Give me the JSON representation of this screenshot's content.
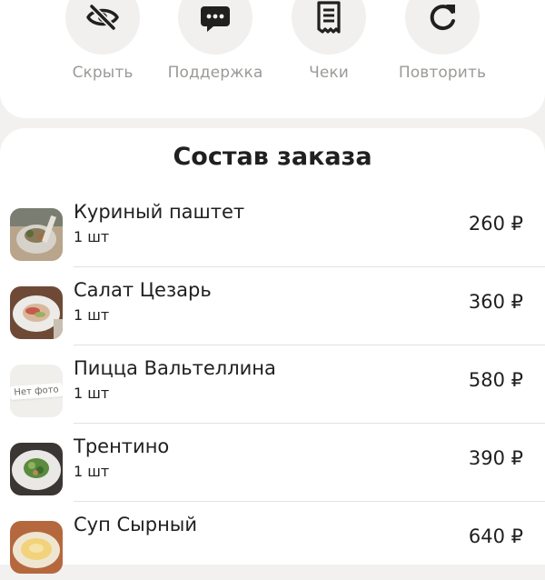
{
  "actions": [
    {
      "label": "Скрыть",
      "icon": "eye-off-icon"
    },
    {
      "label": "Поддержка",
      "icon": "chat-icon"
    },
    {
      "label": "Чеки",
      "icon": "receipt-icon"
    },
    {
      "label": "Повторить",
      "icon": "repeat-icon"
    }
  ],
  "order": {
    "title": "Состав заказа",
    "no_photo_label": "Нет фото",
    "items": [
      {
        "name": "Куриный паштет",
        "qty": "1 шт",
        "price": "260 ₽"
      },
      {
        "name": "Салат Цезарь",
        "qty": "1 шт",
        "price": "360 ₽"
      },
      {
        "name": "Пицца Вальтеллина",
        "qty": "1 шт",
        "price": "580 ₽"
      },
      {
        "name": "Трентино",
        "qty": "1 шт",
        "price": "390 ₽"
      },
      {
        "name": "Суп Сырный",
        "qty": "",
        "price": "640 ₽"
      }
    ]
  },
  "colors": {
    "background": "#f2f1ef",
    "card": "#ffffff",
    "icon_circle": "#f1f0ee",
    "action_label": "#9c9a97",
    "text": "#21201f",
    "divider": "#e4e2df"
  }
}
